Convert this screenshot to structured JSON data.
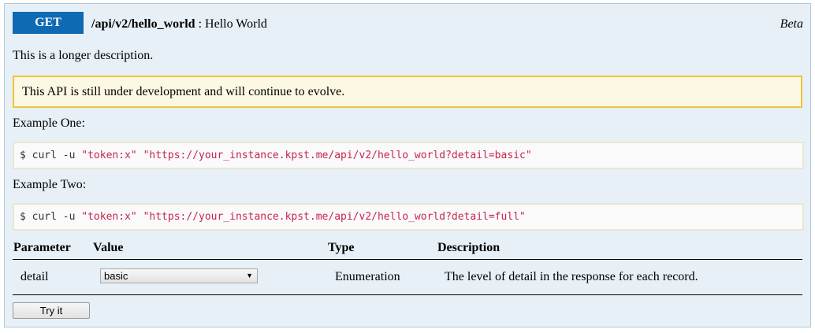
{
  "endpoint": {
    "method": "GET",
    "path": "/api/v2/hello_world",
    "separator": " : ",
    "summary": "Hello World",
    "status": "Beta"
  },
  "description": "This is a longer description.",
  "warning": "This API is still under development and will continue to evolve.",
  "examples": [
    {
      "label": "Example One:",
      "prefix": "$ curl -u ",
      "token": "\"token:x\"",
      "space": " ",
      "url": "\"https://your_instance.kpst.me/api/v2/hello_world?detail=basic\""
    },
    {
      "label": "Example Two:",
      "prefix": "$ curl -u ",
      "token": "\"token:x\"",
      "space": " ",
      "url": "\"https://your_instance.kpst.me/api/v2/hello_world?detail=full\""
    }
  ],
  "params_table": {
    "headers": [
      "Parameter",
      "Value",
      "Type",
      "Description"
    ],
    "rows": [
      {
        "parameter": "detail",
        "value": "basic",
        "type": "Enumeration",
        "description": "The level of detail in the response for each record."
      }
    ]
  },
  "try_button": "Try it",
  "colors": {
    "method_bg": "#0f6ab4",
    "panel_bg": "#e7f0f7",
    "warning_bg": "#fcf8e3",
    "warning_border": "#f0c43a",
    "code_string": "#c7254e"
  }
}
